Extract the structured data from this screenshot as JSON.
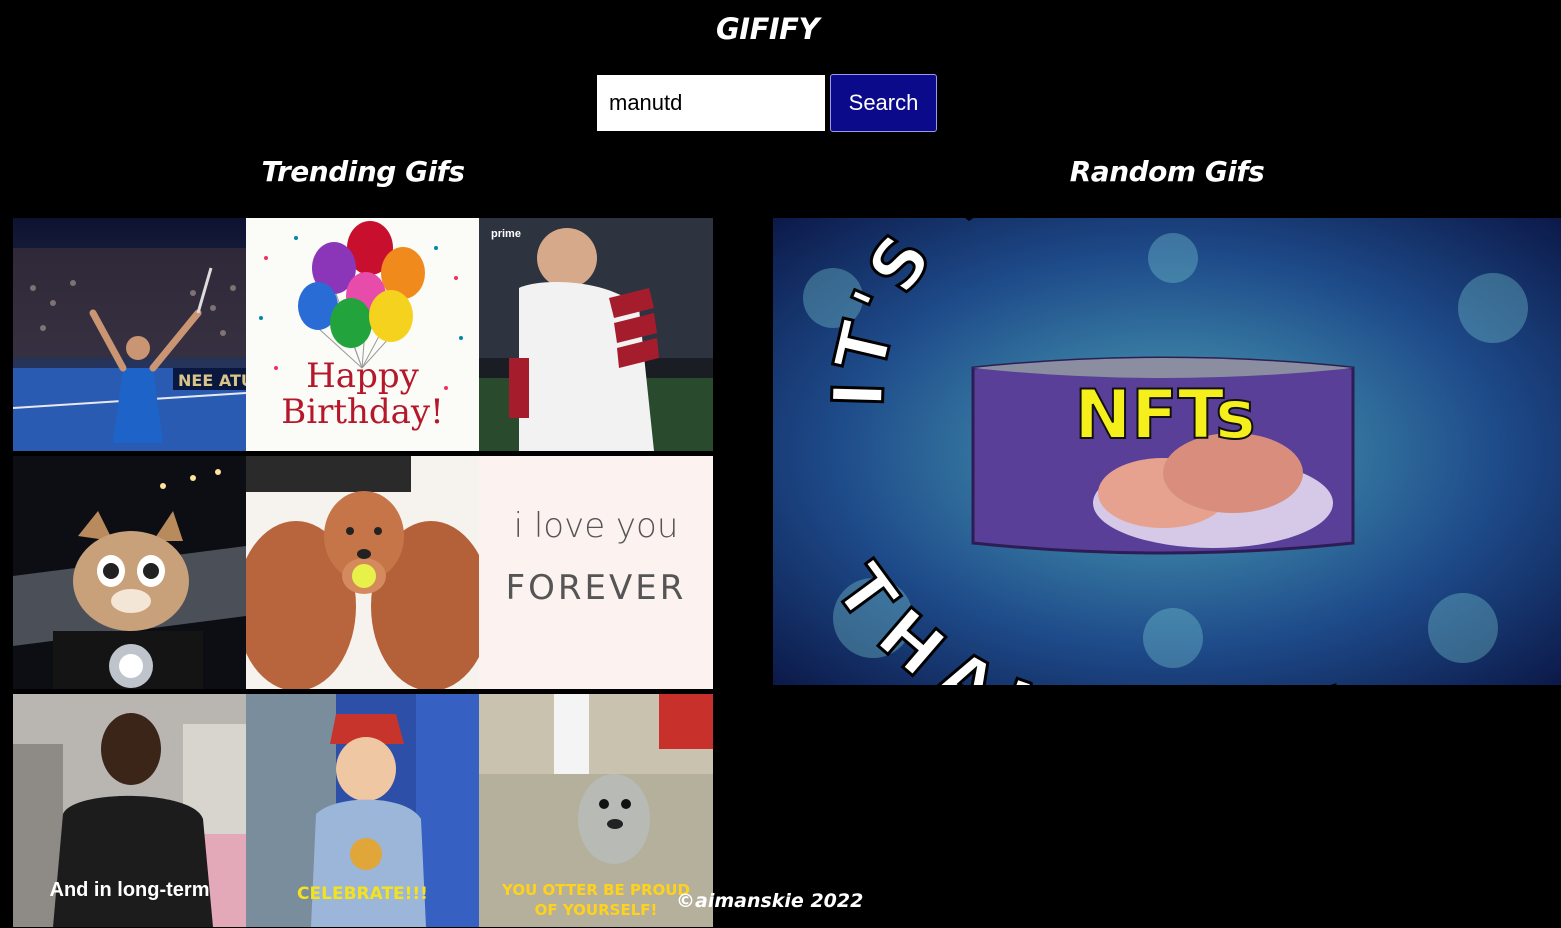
{
  "app": {
    "title": "GIFIFY"
  },
  "search": {
    "value": "manutd",
    "button_label": "Search"
  },
  "trending": {
    "heading": "Trending Gifs",
    "gifs": [
      {
        "subject": "tennis player celebrating in arena",
        "text": ""
      },
      {
        "subject": "happy birthday balloons",
        "text": "Happy\nBirthday!",
        "line1": "Happy",
        "line2": "Birthday!"
      },
      {
        "subject": "football player shouting",
        "text": "prime",
        "badge": "prime"
      },
      {
        "subject": "kitten riding motorcycle at night",
        "text": ""
      },
      {
        "subject": "two golden retrievers with ball",
        "text": ""
      },
      {
        "subject": "i love you forever handwritten",
        "line1": "i love you",
        "line2": "FOREVER"
      },
      {
        "subject": "man speaking in kitchen",
        "caption": "And in long-term"
      },
      {
        "subject": "birthday kid celebrating",
        "caption": "CELEBRATE!!!"
      },
      {
        "subject": "sea otter clapping",
        "line1": "YOU OTTER BE PROUD",
        "line2": "OF YOURSELF!"
      }
    ]
  },
  "random": {
    "heading": "Random Gifs",
    "gif": {
      "subject": "NFTs spam can meme",
      "top_text": "IT'S WORSE",
      "bottom_text": "THAN SPAM",
      "can_label": "NFTs"
    }
  },
  "footer": {
    "text": "©aimanskie 2022"
  },
  "colors": {
    "background": "#000000",
    "button": "#0b0a8a",
    "text": "#ffffff"
  }
}
